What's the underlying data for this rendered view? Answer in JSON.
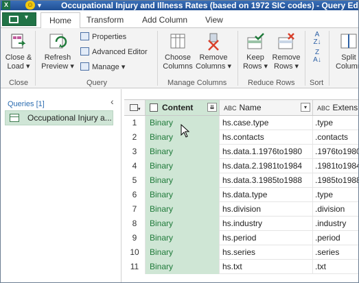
{
  "window": {
    "title": "Occupational Injury and Illness Rates (based on 1972 SIC codes) - Query Edito"
  },
  "ribbon": {
    "tabs": [
      {
        "label": "Home"
      },
      {
        "label": "Transform"
      },
      {
        "label": "Add Column"
      },
      {
        "label": "View"
      }
    ],
    "buttons": {
      "close_load": [
        "Close &",
        "Load"
      ],
      "refresh_preview": [
        "Refresh",
        "Preview"
      ],
      "properties": "Properties",
      "advanced_editor": "Advanced Editor",
      "manage": "Manage",
      "choose_columns": [
        "Choose",
        "Columns"
      ],
      "remove_columns": [
        "Remove",
        "Columns"
      ],
      "keep_rows": [
        "Keep",
        "Rows"
      ],
      "remove_rows": [
        "Remove",
        "Rows"
      ],
      "split_column": [
        "Split",
        "Column"
      ]
    },
    "groups": [
      "Close",
      "Query",
      "Manage Columns",
      "Reduce Rows",
      "Sort"
    ]
  },
  "queries_pane": {
    "header": "Queries [1]",
    "items": [
      {
        "label": "Occupational Injury a..."
      }
    ]
  },
  "grid": {
    "columns": [
      {
        "label": "Content",
        "type_icon": "binary"
      },
      {
        "label": "Name",
        "type_icon": "ABC"
      },
      {
        "label": "Extensio",
        "type_icon": "ABC"
      }
    ],
    "rows": [
      {
        "num": "1",
        "content": "Binary",
        "name": "hs.case.type",
        "ext": ".type"
      },
      {
        "num": "2",
        "content": "Binary",
        "name": "hs.contacts",
        "ext": ".contacts"
      },
      {
        "num": "3",
        "content": "Binary",
        "name": "hs.data.1.1976to1980",
        "ext": ".1976to1980"
      },
      {
        "num": "4",
        "content": "Binary",
        "name": "hs.data.2.1981to1984",
        "ext": ".1981to1984"
      },
      {
        "num": "5",
        "content": "Binary",
        "name": "hs.data.3.1985to1988",
        "ext": ".1985to1988"
      },
      {
        "num": "6",
        "content": "Binary",
        "name": "hs.data.type",
        "ext": ".type"
      },
      {
        "num": "7",
        "content": "Binary",
        "name": "hs.division",
        "ext": ".division"
      },
      {
        "num": "8",
        "content": "Binary",
        "name": "hs.industry",
        "ext": ".industry"
      },
      {
        "num": "9",
        "content": "Binary",
        "name": "hs.period",
        "ext": ".period"
      },
      {
        "num": "10",
        "content": "Binary",
        "name": "hs.series",
        "ext": ".series"
      },
      {
        "num": "11",
        "content": "Binary",
        "name": "hs.txt",
        "ext": ".txt"
      }
    ]
  },
  "colors": {
    "accent_green": "#217346",
    "binary_text": "#1f7a3a",
    "selected_column_bg": "#cfe6d5"
  }
}
